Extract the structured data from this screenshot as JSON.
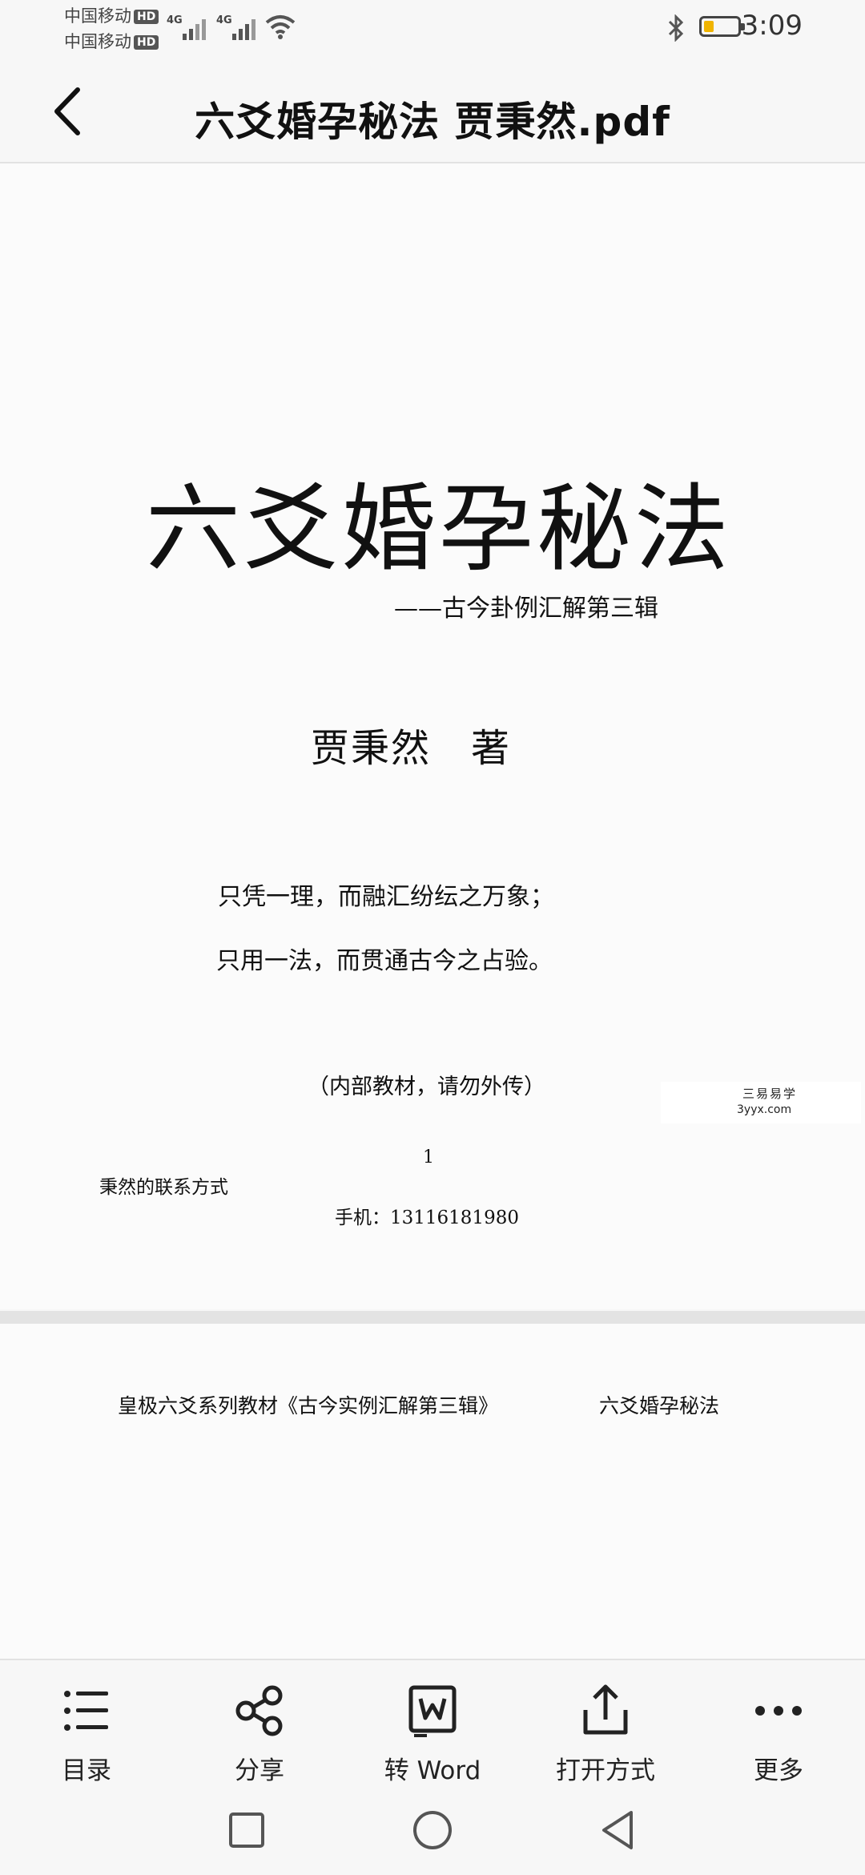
{
  "status_bar": {
    "carrier_1": "中国移动",
    "carrier_2": "中国移动",
    "hd_badge": "HD",
    "network_1": "4G",
    "network_2": "4G",
    "battery_level": 0.3,
    "time": "3:09"
  },
  "header": {
    "title": "六爻婚孕秘法 贾秉然.pdf"
  },
  "page1": {
    "book_title": "六爻婚孕秘法",
    "subtitle": "——古今卦例汇解第三辑",
    "author": "贾秉然　著",
    "verse_1": "只凭一理，而融汇纷纭之万象；",
    "verse_2": "只用一法，而贯通古今之占验。",
    "internal_note": "（内部教材，请勿外传）",
    "page_number": "1",
    "contact_label": "秉然的联系方式",
    "phone": "手机：13116181980"
  },
  "watermark": {
    "line_1": "三易易学",
    "line_2": "3yyx.com"
  },
  "page2": {
    "header_left": "皇极六爻系列教材《古今实例汇解第三辑》",
    "header_right": "六爻婚孕秘法"
  },
  "toolbar": {
    "items": [
      {
        "label": "目录",
        "icon": "list-icon"
      },
      {
        "label": "分享",
        "icon": "share-icon"
      },
      {
        "label": "转 Word",
        "icon": "word-convert-icon"
      },
      {
        "label": "打开方式",
        "icon": "open-with-icon"
      },
      {
        "label": "更多",
        "icon": "more-icon"
      }
    ]
  }
}
